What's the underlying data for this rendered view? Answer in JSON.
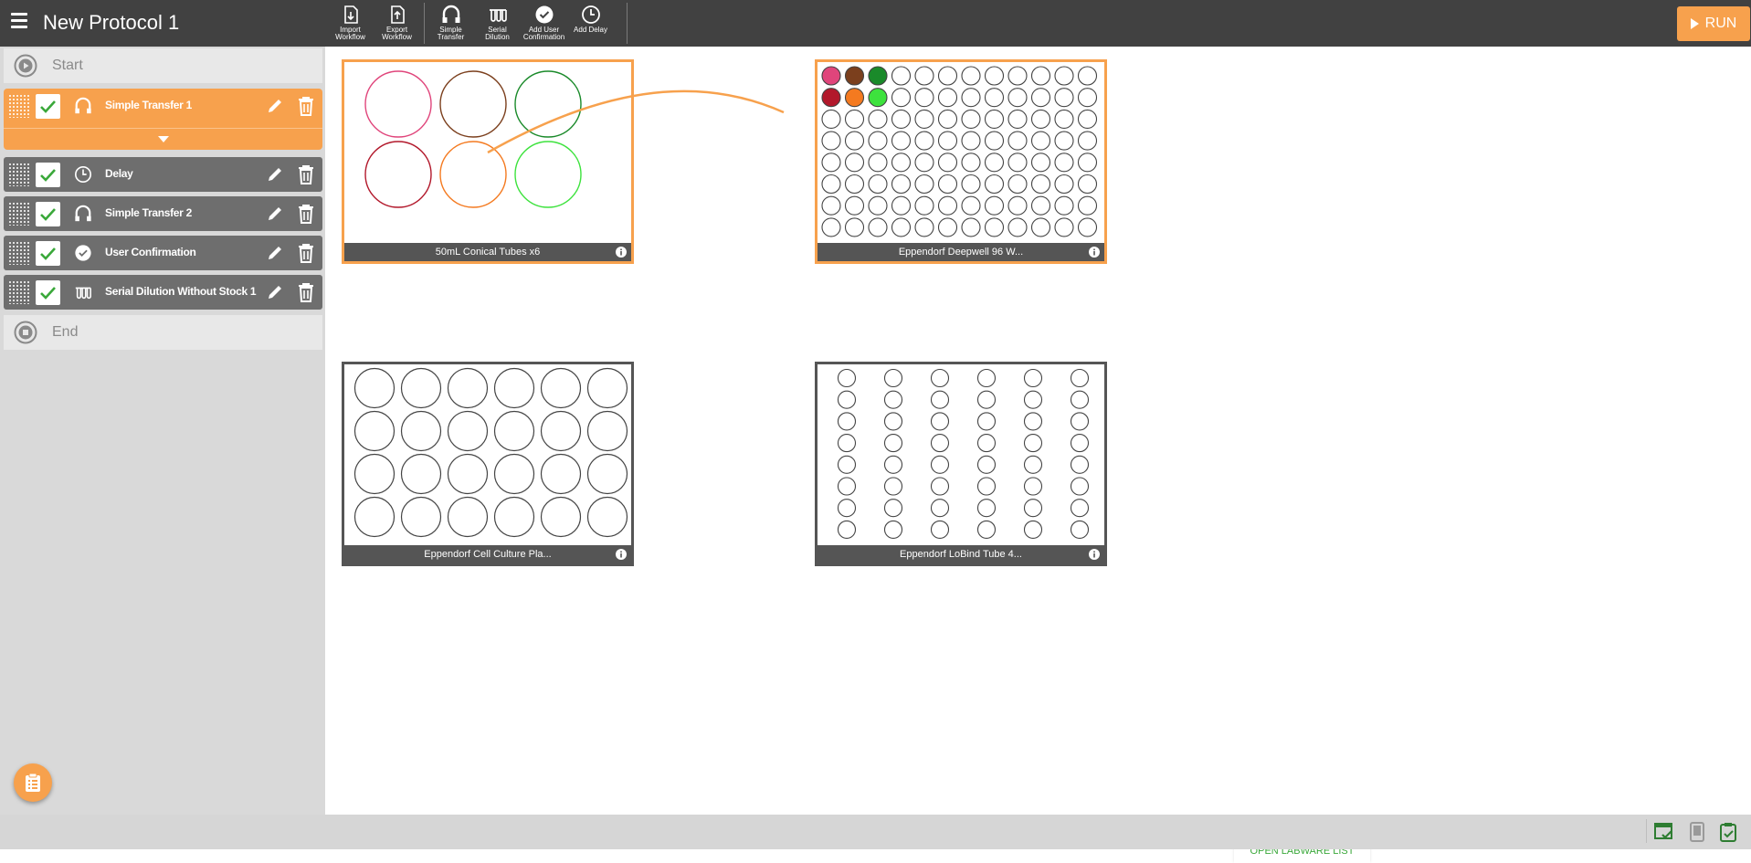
{
  "app": {
    "title": "New Protocol 1",
    "run_label": "RUN"
  },
  "toolbar": {
    "import_label": "Import\nWorkflow",
    "export_label": "Export\nWorkflow",
    "simple_transfer_label": "Simple\nTransfer",
    "serial_dilution_label": "Serial\nDilution",
    "add_user_confirmation_label": "Add User\nConfirmation",
    "add_delay_label": "Add Delay"
  },
  "sidebar": {
    "start_label": "Start",
    "end_label": "End",
    "steps": [
      {
        "label": "Simple Transfer 1",
        "icon": "simple-transfer-icon",
        "active": true
      },
      {
        "label": "Delay",
        "icon": "clock-icon",
        "active": false
      },
      {
        "label": "Simple Transfer 2",
        "icon": "simple-transfer-icon",
        "active": false
      },
      {
        "label": "User Confirmation",
        "icon": "check-circle-icon",
        "active": false
      },
      {
        "label": "Serial Dilution Without Stock 1",
        "icon": "serial-dilution-icon",
        "active": false
      }
    ]
  },
  "labware": [
    {
      "name": "50mL Conical Tubes x6",
      "selected": true,
      "rows": 2,
      "cols": 3,
      "well_colors": [
        "#e0457b",
        "#7b3f1d",
        "#1a8a2a",
        "#b2182b",
        "#f47a20",
        "#3de23d"
      ]
    },
    {
      "name": "Eppendorf Deepwell 96 W...",
      "selected": true,
      "rows": 8,
      "cols": 12,
      "filled": [
        {
          "row": 0,
          "col": 0,
          "color": "#e0457b"
        },
        {
          "row": 0,
          "col": 1,
          "color": "#7b3f1d"
        },
        {
          "row": 0,
          "col": 2,
          "color": "#1a8a2a"
        },
        {
          "row": 1,
          "col": 0,
          "color": "#b2182b"
        },
        {
          "row": 1,
          "col": 1,
          "color": "#f47a20"
        },
        {
          "row": 1,
          "col": 2,
          "color": "#3de23d"
        }
      ]
    },
    {
      "name": "Eppendorf Cell Culture Pla...",
      "selected": false,
      "rows": 4,
      "cols": 6
    },
    {
      "name": "Eppendorf LoBind Tube 4...",
      "selected": false,
      "rows": 8,
      "cols": 6
    }
  ],
  "canvas": {
    "open_labware_label": "OPEN LABWARE LIST"
  },
  "colors": {
    "accent": "#f7a14d",
    "topbar": "#414141",
    "step": "#6e6e6e",
    "check": "#3aa83a",
    "link": "#3aa83a"
  }
}
